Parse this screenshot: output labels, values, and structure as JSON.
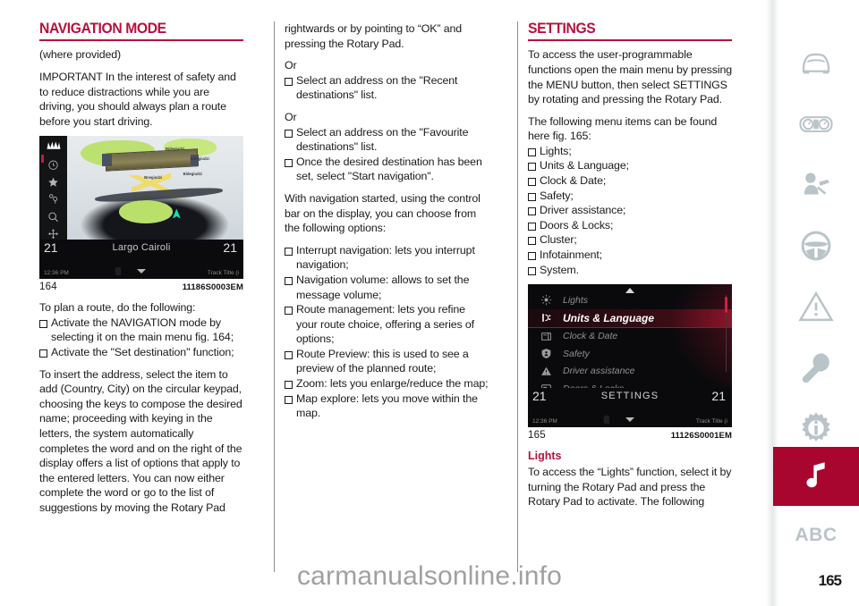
{
  "document": {
    "page_number": "165",
    "watermark": "carmanualsonline.info"
  },
  "columns": {
    "col1": {
      "heading": "NAVIGATION MODE",
      "subtitle": "(where provided)",
      "intro": "IMPORTANT In the interest of safety and to reduce distractions while you are driving, you should always plan a route before you start driving.",
      "figure": {
        "number": "164",
        "code": "11186S0003EM",
        "screen": {
          "street": "Largo Cairoli",
          "left_value": "21",
          "right_value": "21",
          "time": "12:36 PM",
          "track": "Track Title (i",
          "map_labels": [
            "Bidegiudzi",
            "Bidegiudzi",
            "Bidegiudzi",
            "Bnegiudzi"
          ],
          "icons": [
            "brand-logo",
            "recent-icon",
            "favourite-icon",
            "poi-icon",
            "zoom-icon",
            "map-explore-icon"
          ]
        }
      },
      "plan_intro": "To plan a route, do the following:",
      "plan_steps": [
        "Activate the NAVIGATION mode by selecting it on the main menu fig. 164;",
        "Activate the \"Set destination\" function;"
      ],
      "address_para": "To insert the address, select the item to add (Country, City) on the circular keypad, choosing the keys to compose the desired name; proceeding with keying in the letters, the system automatically completes the word and on the right of the display offers a list of options that apply to the entered letters. You can now either complete the word or go to the list of suggestions by moving the Rotary Pad"
    },
    "col2": {
      "cont_para": "rightwards or by pointing to “OK” and pressing the Rotary Pad.",
      "or_1": "Or",
      "bullet_recent": "Select an address on the \"Recent destinations\" list.",
      "or_2": "Or",
      "bullet_favourite": "Select an address on the \"Favourite destinations\" list.",
      "bullet_start": "Once the desired destination has been set, select \"Start navigation\".",
      "options_intro": "With navigation started, using the control bar on the display, you can choose from the following options:",
      "options": [
        "Interrupt navigation: lets you interrupt navigation;",
        "Navigation volume: allows to set the message volume;",
        "Route management: lets you refine your route choice, offering a series of options;",
        "Route Preview: this is used to see a preview of the planned route;",
        "Zoom: lets you enlarge/reduce the map;",
        "Map explore: lets you move within the map."
      ]
    },
    "col3": {
      "heading": "SETTINGS",
      "intro": "To access the user-programmable functions open the main menu by pressing the MENU button, then select SETTINGS by rotating and pressing the Rotary Pad.",
      "menu_intro": "The following menu items can be found here fig. 165:",
      "menu_items": [
        "Lights;",
        "Units & Language;",
        "Clock & Date;",
        "Safety;",
        "Driver assistance;",
        "Doors & Locks;",
        "Cluster;",
        "Infotainment;",
        "System."
      ],
      "figure": {
        "number": "165",
        "code": "11126S0001EM",
        "screen": {
          "title": "SETTINGS",
          "left_value": "21",
          "right_value": "21",
          "time": "12:36 PM",
          "track": "Track Title (i",
          "rows": [
            {
              "label": "Lights",
              "icon": "lights-icon",
              "selected": false
            },
            {
              "label": "Units & Language",
              "icon": "units-language-icon",
              "selected": true
            },
            {
              "label": "Clock & Date",
              "icon": "clock-date-icon",
              "selected": false
            },
            {
              "label": "Safety",
              "icon": "safety-shield-icon",
              "selected": false
            },
            {
              "label": "Driver assistance",
              "icon": "driver-assistance-warning-icon",
              "selected": false
            },
            {
              "label": "Doors & Locks",
              "icon": "doors-locks-icon",
              "selected": false
            }
          ]
        }
      },
      "lights_heading": "Lights",
      "lights_para": "To access the “Lights” function, select it by turning the Rotary Pad and press the Rotary Pad to activate. The following"
    }
  },
  "rail": {
    "active_color": "#a8062f",
    "icon_color": "#b9c4c8",
    "items": [
      {
        "name": "car-front-icon",
        "label": ""
      },
      {
        "name": "instrument-cluster-icon",
        "label": ""
      },
      {
        "name": "airbag-safety-icon",
        "label": ""
      },
      {
        "name": "steering-wheel-icon",
        "label": ""
      },
      {
        "name": "warning-triangle-icon",
        "label": ""
      },
      {
        "name": "wrench-icon",
        "label": ""
      },
      {
        "name": "info-gear-icon",
        "label": ""
      },
      {
        "name": "music-note-icon",
        "label": ""
      },
      {
        "name": "abc-index-icon",
        "label": "ABC"
      }
    ]
  }
}
